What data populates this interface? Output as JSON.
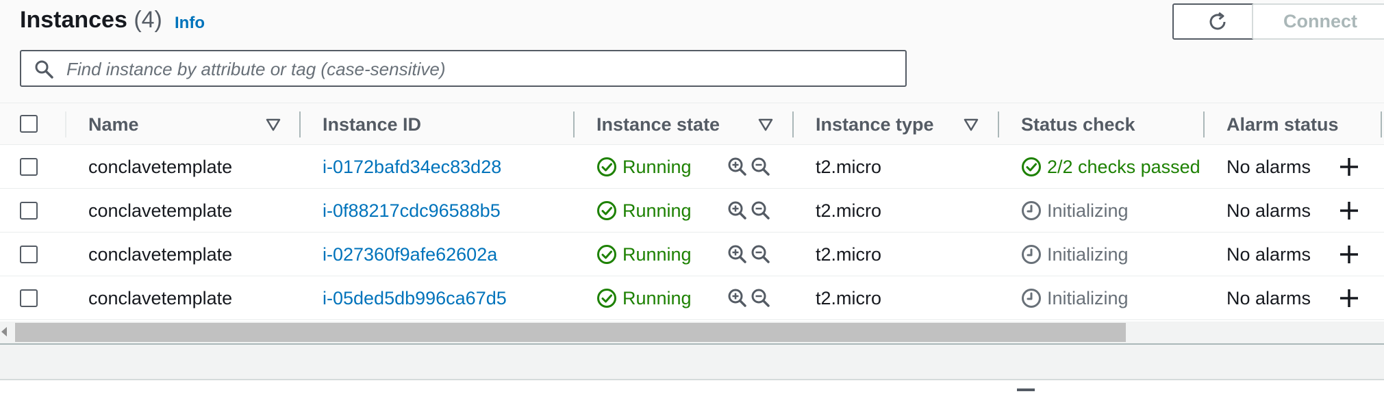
{
  "header": {
    "title": "Instances",
    "count": "(4)",
    "info_label": "Info",
    "connect_label": "Connect"
  },
  "search": {
    "placeholder": "Find instance by attribute or tag (case-sensitive)"
  },
  "table": {
    "columns": [
      {
        "label": "Name",
        "sortable": true
      },
      {
        "label": "Instance ID",
        "sortable": false
      },
      {
        "label": "Instance state",
        "sortable": true
      },
      {
        "label": "Instance type",
        "sortable": true
      },
      {
        "label": "Status check",
        "sortable": false
      },
      {
        "label": "Alarm status",
        "sortable": false
      }
    ],
    "rows": [
      {
        "name": "conclavetemplate",
        "instance_id": "i-0172bafd34ec83d28",
        "state": "Running",
        "type": "t2.micro",
        "status_check": "2/2 checks passed",
        "status_kind": "passed",
        "alarm": "No alarms"
      },
      {
        "name": "conclavetemplate",
        "instance_id": "i-0f88217cdc96588b5",
        "state": "Running",
        "type": "t2.micro",
        "status_check": "Initializing",
        "status_kind": "init",
        "alarm": "No alarms"
      },
      {
        "name": "conclavetemplate",
        "instance_id": "i-027360f9afe62602a",
        "state": "Running",
        "type": "t2.micro",
        "status_check": "Initializing",
        "status_kind": "init",
        "alarm": "No alarms"
      },
      {
        "name": "conclavetemplate",
        "instance_id": "i-05ded5db996ca67d5",
        "state": "Running",
        "type": "t2.micro",
        "status_check": "Initializing",
        "status_kind": "init",
        "alarm": "No alarms"
      }
    ]
  },
  "icons": {
    "refresh": "refresh-icon",
    "search": "search-icon",
    "sort": "sort-down-triangle-icon",
    "running": "check-circle-icon",
    "zoom_in": "zoom-in-icon",
    "zoom_out": "zoom-out-icon",
    "passed": "check-circle-icon",
    "initializing": "clock-icon",
    "add_alarm": "plus-icon"
  },
  "colors": {
    "link": "#0073bb",
    "success": "#1d8102",
    "muted": "#687078",
    "border": "#545b64"
  }
}
